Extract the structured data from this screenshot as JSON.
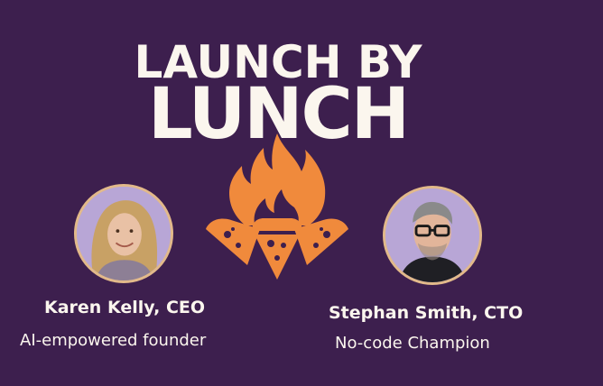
{
  "title": {
    "line1": "LAUNCH BY",
    "line2": "LUNCH"
  },
  "logo": {
    "icon": "flame-pizza-icon",
    "color": "#f08a3c"
  },
  "speakers": [
    {
      "name": "Karen Kelly, CEO",
      "role": "AI-empowered founder"
    },
    {
      "name": "Stephan Smith, CTO",
      "role": "No-code Champion"
    }
  ],
  "colors": {
    "background": "#3d1f4e",
    "text": "#fbf6ee",
    "accent": "#f08a3c",
    "avatar_bg": "#b8a6d6",
    "avatar_border": "#e2b98a"
  }
}
